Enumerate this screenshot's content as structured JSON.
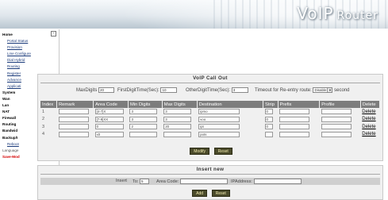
{
  "header": {
    "logo_main": "VoIP",
    "logo_sub": "Router"
  },
  "sidebar": {
    "collapse_glyph": "-",
    "items": [
      {
        "label": "Home",
        "kind": "lvl1"
      },
      {
        "label": "Portal Status",
        "kind": "lvl2"
      },
      {
        "label": "Provision",
        "kind": "lvl2"
      },
      {
        "label": "Line Configure",
        "kind": "lvl2"
      },
      {
        "label": "Dial Hybrid",
        "kind": "lvl2"
      },
      {
        "label": "Routing",
        "kind": "lvl2"
      },
      {
        "label": "Register",
        "kind": "lvl2"
      },
      {
        "label": "Advance",
        "kind": "lvl2"
      },
      {
        "label": "Applicati",
        "kind": "lvl2"
      },
      {
        "label": "System",
        "kind": "lvl1"
      },
      {
        "label": "Wan",
        "kind": "lvl1"
      },
      {
        "label": "Lan",
        "kind": "lvl1"
      },
      {
        "label": "NAT",
        "kind": "lvl1"
      },
      {
        "label": "Firewall",
        "kind": "lvl1"
      },
      {
        "label": "Routing",
        "kind": "lvl1"
      },
      {
        "label": "Bandwid",
        "kind": "lvl1"
      },
      {
        "label": "Backup/I",
        "kind": "lvl1"
      },
      {
        "label": "Reboot",
        "kind": "lvl2"
      },
      {
        "label": "Language",
        "kind": "plain"
      },
      {
        "label": "Save-Mod",
        "kind": "red"
      }
    ]
  },
  "call_out": {
    "title": "VoIP Call Out",
    "max_digits_label": "MaxDigits",
    "max_digits_value": "20",
    "first_digit_time_label": "FirstDigitTime(Sec):",
    "first_digit_time_value": "10",
    "other_digit_time_label": "OtherDigitTime(Sec):",
    "other_digit_time_value": "3",
    "timeout_label": "Timeout for Re-entry route:",
    "timeout_value": "Disable",
    "timeout_unit": "second",
    "columns": [
      "Index",
      "Remark",
      "Area Code",
      "Min Digits",
      "Max Digits",
      "Destination",
      "Strip",
      "Prefix",
      "Profile",
      "Delete"
    ],
    "rows": [
      {
        "index": "1",
        "remark": "",
        "area_code": "[4-7]X",
        "min": "3",
        "max": "3",
        "dest": "ipmo",
        "strip": "0",
        "prefix": "",
        "profile": "",
        "delete": "Delete"
      },
      {
        "index": "2",
        "remark": "",
        "area_code": "[7-9]XX",
        "min": "3",
        "max": "3",
        "dest": "voo",
        "strip": "0",
        "prefix": "",
        "profile": "",
        "delete": "Delete"
      },
      {
        "index": "3",
        "remark": "",
        "area_code": "0",
        "min": "2",
        "max": "20",
        "dest": "ipt",
        "strip": "0",
        "prefix": "",
        "profile": "",
        "delete": "Delete"
      },
      {
        "index": "4",
        "remark": "",
        "area_code": "x0",
        "min": "",
        "max": "",
        "dest": "pots",
        "strip": "",
        "prefix": "",
        "profile": "",
        "delete": "Delete"
      }
    ],
    "modify_label": "Modify",
    "reset_label": "Reset"
  },
  "insert": {
    "title": "Insert new",
    "insert_label": "Insert",
    "to_label": "To:",
    "to_value": "5",
    "area_code_label": "Area Code:",
    "area_code_value": "",
    "ip_label": "IPAddress:",
    "ip_value": "",
    "add_label": "Add",
    "reset_label": "Reset"
  }
}
